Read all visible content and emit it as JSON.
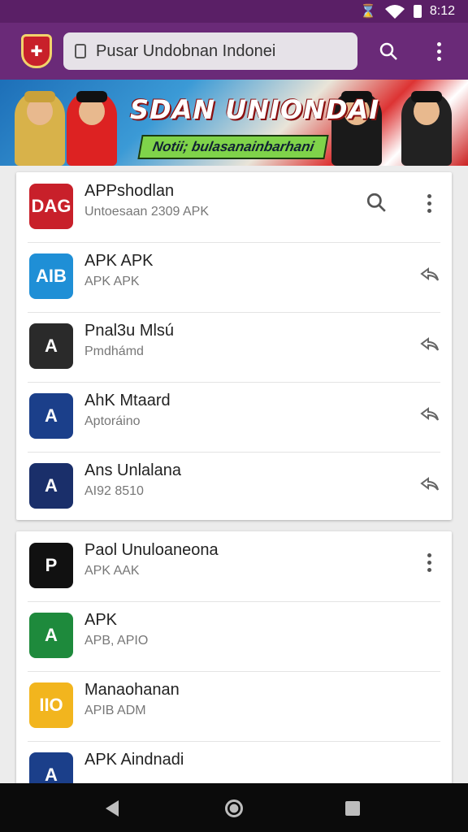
{
  "status": {
    "time": "8:12",
    "bluetooth_icon": "bluetooth-icon",
    "wifi_icon": "wifi-icon",
    "battery_icon": "battery-icon"
  },
  "header": {
    "logo_icon": "shield-logo-icon",
    "search_value": "Pusar Undobnan Indonei",
    "search_icon": "search-icon",
    "more_icon": "more-vert-icon"
  },
  "banner": {
    "title": "SDAN UNIONDAI",
    "subtitle": "Notii; bulasanainbarhani"
  },
  "apps_primary": [
    {
      "title": "APPshodlan",
      "subtitle": "Untoesaan  2309  APK",
      "action": "search-more",
      "icon_text": "DAG",
      "icon_color": "#c8202a"
    },
    {
      "title": "APK APK",
      "subtitle": "APK  APK",
      "action": "reply",
      "icon_text": "AIB",
      "icon_color": "#1f8fd6"
    },
    {
      "title": "Pnal3u Mlsú",
      "subtitle": "Pmdhámd",
      "action": "reply",
      "icon_text": "A",
      "icon_color": "#2a2a2a"
    },
    {
      "title": "AhK Mtaard",
      "subtitle": "Aptoráino",
      "action": "reply",
      "icon_text": "A",
      "icon_color": "#1b3f8a"
    },
    {
      "title": "Ans Unlalana",
      "subtitle": "AI92  8510",
      "action": "reply",
      "icon_text": "A",
      "icon_color": "#1a2f6a"
    }
  ],
  "apps_secondary": [
    {
      "title": "Paol Unuloaneona",
      "subtitle": "APK  AAK",
      "action": "more",
      "icon_text": "P",
      "icon_color": "#111111"
    },
    {
      "title": "APK",
      "subtitle": "APB, APIO",
      "action": "none",
      "icon_text": "A",
      "icon_color": "#1e8a3c"
    },
    {
      "title": "Manaohanan",
      "subtitle": "APIB  ADM",
      "action": "none",
      "icon_text": "IIO",
      "icon_color": "#f2b51e"
    },
    {
      "title": "APK Aindnadi",
      "subtitle": "",
      "action": "none",
      "icon_text": "A",
      "icon_color": "#1b3f8a"
    }
  ],
  "nav": {
    "back_icon": "back-icon",
    "home_icon": "home-icon",
    "recents_icon": "recents-icon"
  }
}
